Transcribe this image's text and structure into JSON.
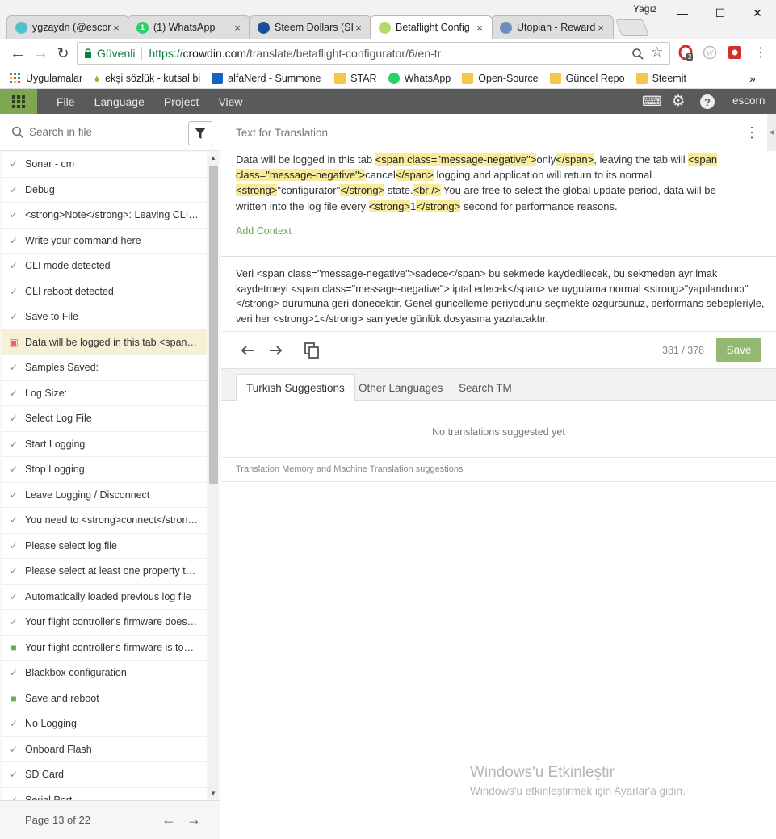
{
  "window": {
    "user": "Yağız",
    "controls": {
      "minimize": "—",
      "maximize": "☐",
      "close": "✕"
    }
  },
  "tabs": [
    {
      "label": "ygzaydn (@escorn",
      "favicon_color": "#4fc3c7",
      "favicon": ""
    },
    {
      "label": "(1) WhatsApp",
      "favicon_color": "#25d366",
      "favicon": "1"
    },
    {
      "label": "Steem Dollars (SI",
      "favicon_color": "#1a5099",
      "favicon": ""
    },
    {
      "label": "Betaflight Config",
      "favicon_color": "#b7d96b",
      "favicon": ""
    },
    {
      "label": "Utopian - Reward",
      "favicon_color": "#6c8ebf",
      "favicon": ""
    }
  ],
  "tab_close": "×",
  "address": {
    "secure_label": "Güvenli",
    "url_scheme": "https://",
    "url_host": "crowdin.com",
    "url_path": "/translate/betaflight-configurator/6/en-tr"
  },
  "extensions": {
    "opera_badge": "2"
  },
  "bookmarks": [
    {
      "label": "Uygulamalar",
      "icon": "apps-grid"
    },
    {
      "label": "ekşi sözlük - kutsal bi",
      "icon": "drop"
    },
    {
      "label": "alfaNerd - Summone",
      "icon": "alfa"
    },
    {
      "label": "STAR",
      "icon": "folder"
    },
    {
      "label": "WhatsApp",
      "icon": "whatsapp"
    },
    {
      "label": "Open-Source",
      "icon": "folder"
    },
    {
      "label": "Güncel Repo",
      "icon": "folder"
    },
    {
      "label": "Steemit",
      "icon": "folder"
    }
  ],
  "bookmarks_more": "»",
  "app_menu": [
    "File",
    "Language",
    "Project",
    "View"
  ],
  "app_user": "escorn",
  "search": {
    "placeholder": "Search in file",
    "value": ""
  },
  "strings": [
    {
      "text": "Sonar - cm",
      "status": "translated"
    },
    {
      "text": "Debug",
      "status": "translated"
    },
    {
      "text": "<strong>Note</strong>: Leaving CLI tab",
      "status": "translated"
    },
    {
      "text": "Write your command here",
      "status": "translated"
    },
    {
      "text": "CLI mode detected",
      "status": "translated"
    },
    {
      "text": "CLI reboot detected",
      "status": "translated"
    },
    {
      "text": "Save to File",
      "status": "translated"
    },
    {
      "text": "Data will be logged in this tab <span class",
      "status": "current"
    },
    {
      "text": "Samples Saved:",
      "status": "translated"
    },
    {
      "text": "Log Size:",
      "status": "translated"
    },
    {
      "text": "Select Log File",
      "status": "translated"
    },
    {
      "text": "Start Logging",
      "status": "translated"
    },
    {
      "text": "Stop Logging",
      "status": "translated"
    },
    {
      "text": "Leave Logging / Disconnect",
      "status": "translated"
    },
    {
      "text": "You need to <strong>connect</strong> first",
      "status": "translated"
    },
    {
      "text": "Please select log file",
      "status": "translated"
    },
    {
      "text": "Please select at least one property to log",
      "status": "translated"
    },
    {
      "text": "Automatically loaded previous log file",
      "status": "translated"
    },
    {
      "text": "Your flight controller's firmware does not",
      "status": "translated"
    },
    {
      "text": "Your flight controller's firmware is too old",
      "status": "approved"
    },
    {
      "text": "Blackbox configuration",
      "status": "translated"
    },
    {
      "text": "Save and reboot",
      "status": "approved"
    },
    {
      "text": "No Logging",
      "status": "translated"
    },
    {
      "text": "Onboard Flash",
      "status": "translated"
    },
    {
      "text": "SD Card",
      "status": "translated"
    },
    {
      "text": "Serial Port",
      "status": "translated"
    }
  ],
  "status_marks": {
    "translated": "✓",
    "approved": "■",
    "current": "▣"
  },
  "pager": {
    "label": "Page 13 of 22"
  },
  "source": {
    "header": "Text for Translation",
    "segments": [
      {
        "t": "Data will be logged in this tab ",
        "tag": false
      },
      {
        "t": "<span class=\"message-negative\">",
        "tag": true
      },
      {
        "t": "only",
        "tag": false
      },
      {
        "t": "</span>",
        "tag": true
      },
      {
        "t": ", leaving the tab will ",
        "tag": false
      },
      {
        "t": "<span class=\"message-negative\">",
        "tag": true
      },
      {
        "t": "cancel",
        "tag": false
      },
      {
        "t": "</span>",
        "tag": true
      },
      {
        "t": " logging and application will return to its normal ",
        "tag": false
      },
      {
        "t": "<strong>",
        "tag": true
      },
      {
        "t": "\"configurator\"",
        "tag": false
      },
      {
        "t": "</strong>",
        "tag": true
      },
      {
        "t": " state.",
        "tag": false
      },
      {
        "t": "<br />",
        "tag": true
      },
      {
        "t": " You are free to select the global update period, data will be written into the log file every ",
        "tag": false
      },
      {
        "t": "<strong>",
        "tag": true
      },
      {
        "t": "1",
        "tag": false
      },
      {
        "t": "</strong>",
        "tag": true
      },
      {
        "t": " second for performance reasons.",
        "tag": false
      }
    ],
    "add_context": "Add Context"
  },
  "translation": {
    "text": "Veri <span class=\"message-negative\">sadece</span> bu sekmede kaydedilecek, bu sekmeden ayrılmak kaydetmeyi <span class=\"message-negative\"> iptal edecek</span> ve uygulama normal <strong>\"yapılandırıcı\"</strong> durumuna geri dönecektir. Genel güncelleme periyodunu seçmekte özgürsünüz, performans sebepleriyle, veri her <strong>1</strong> saniyede günlük dosyasına yazılacaktır.",
    "counter": "381 / 378",
    "save_label": "Save"
  },
  "suggestion_tabs": [
    "Turkish Suggestions",
    "Other Languages",
    "Search TM"
  ],
  "no_suggestions": "No translations suggested yet",
  "tm_label": "Translation Memory and Machine Translation suggestions",
  "watermark": {
    "title": "Windows'u Etkinleştir",
    "subtitle": "Windows'u etkinleştirmek için Ayarlar'a gidin."
  }
}
